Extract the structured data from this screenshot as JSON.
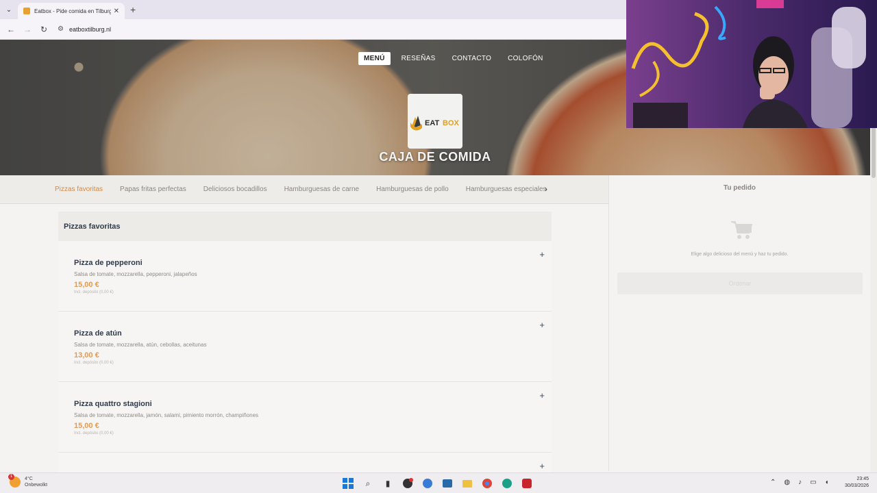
{
  "browser": {
    "tab_title": "Eatbox - Pide comida en Tilburg",
    "url": "eatboxtilburg.nl"
  },
  "nav": {
    "items": [
      "MENÚ",
      "RESEÑAS",
      "CONTACTO",
      "COLOFÓN"
    ],
    "active": "MENÚ"
  },
  "hero": {
    "logo_text": "EATBOX",
    "title": "CAJA DE COMIDA"
  },
  "categories": {
    "items": [
      "Pizzas favoritas",
      "Papas fritas perfectas",
      "Deliciosos bocadillos",
      "Hamburguesas de carne",
      "Hamburguesas de pollo",
      "Hamburguesas especiales"
    ],
    "active": "Pizzas favoritas"
  },
  "menu": {
    "section_title": "Pizzas favoritas",
    "items": [
      {
        "name": "Pizza de pepperoni",
        "desc": "Salsa de tomate, mozzarella, pepperoni, jalapeños",
        "price": "15,00 €",
        "deposit": "Incl. depósito (0,00 €)"
      },
      {
        "name": "Pizza de atún",
        "desc": "Salsa de tomate, mozzarella, atún, cebollas, aceitunas",
        "price": "13,00 €",
        "deposit": "Incl. depósito (0,00 €)"
      },
      {
        "name": "Pizza quattro stagioni",
        "desc": "Salsa de tomate, mozzarella, jamón, salami, pimiento morrón, champiñones",
        "price": "15,00 €",
        "deposit": "Incl. depósito (0,00 €)"
      }
    ]
  },
  "order": {
    "title": "Tu pedido",
    "hint": "Elige algo delicioso del menú y haz tu pedido.",
    "button": "Ordenar"
  },
  "taskbar": {
    "temperature": "4°C",
    "weather": "Onbewolkt",
    "notification_count": "1",
    "time": "23:45",
    "date": "30/03/2026"
  },
  "colors": {
    "accent": "#d28a48",
    "price": "#e39a52",
    "heading": "#2f3a4a"
  }
}
